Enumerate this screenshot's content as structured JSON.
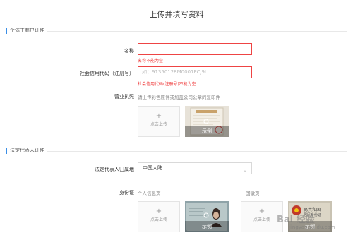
{
  "page_title": "上传并填写资料",
  "section1": {
    "title": "个体工商户证件",
    "name_label": "名称",
    "name_value": "",
    "name_error": "名称不能为空",
    "credit_label": "社会信用代码（注册号）",
    "credit_placeholder": "如：91350128M0001FCJ9L",
    "credit_error": "社会信用代码(注册号)不能为空",
    "license_label": "营业执照",
    "license_hint": "请上传彩色原件或加盖公司公章的复印件",
    "upload_plus": "+",
    "upload_label": "点击上传",
    "sample_label": "示例"
  },
  "section2": {
    "title": "法定代表人证件",
    "region_label": "法定代表人归属地",
    "region_value": "中国大陆",
    "id_label": "身份证",
    "id_front_label": "个人信息页",
    "id_back_label": "国徽页",
    "upload_plus": "+",
    "upload_label": "点击上传",
    "sample_label": "示例",
    "id_back_sample_text": "民共和国",
    "id_back_sample_subtext": "居民身份证"
  },
  "watermark": {
    "text": "Bai 经验",
    "url": "jingyan.baidu.com"
  },
  "colors": {
    "accent": "#3a8ee6",
    "error": "#e33e3e",
    "border": "#d9d9d9"
  }
}
